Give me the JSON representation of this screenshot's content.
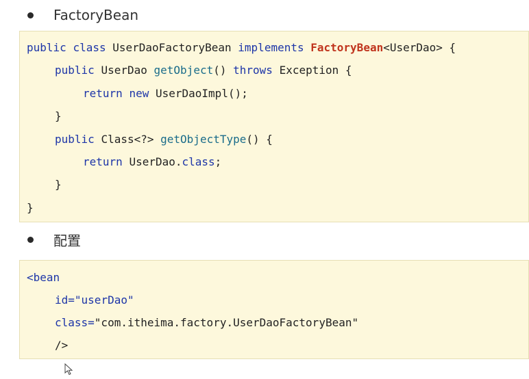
{
  "bullets": {
    "first": "FactoryBean",
    "second": "配置"
  },
  "java_code": {
    "l1": {
      "public": "public",
      "class": "class",
      "classname": "UserDaoFactoryBean",
      "implements": "implements",
      "iface": "FactoryBean",
      "generic": "<UserDao> {"
    },
    "l2": {
      "public": "public",
      "type": "UserDao",
      "method": "getObject",
      "parens": "()",
      "throws": "throws",
      "exception": "Exception {"
    },
    "l3": {
      "return": "return",
      "new": "new",
      "ctor": "UserDaoImpl();"
    },
    "l4": "}",
    "l5": {
      "public": "public",
      "type": "Class<?>",
      "method": "getObjectType",
      "rest": "() {"
    },
    "l6": {
      "return": "return",
      "value": "UserDao.",
      "class": "class",
      "semi": ";"
    },
    "l7": "}",
    "l8": "}"
  },
  "xml_code": {
    "l1": "<bean",
    "l2": {
      "attr": "id=",
      "value": "\"userDao\""
    },
    "l3": {
      "attr": "class=",
      "value": "\"com.itheima.factory.UserDaoFactoryBean\""
    },
    "l4": "/>"
  },
  "icons": {
    "bullet": "bullet-dot-icon",
    "cursor": "mouse-pointer-icon"
  },
  "colors": {
    "code_background": "#fdf8dc",
    "keyword": "#1d35a8",
    "method": "#1a6c8a",
    "highlight": "#c0341d"
  }
}
